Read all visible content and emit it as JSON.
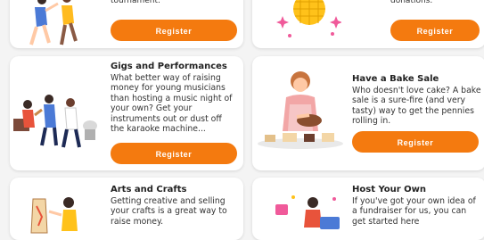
{
  "cards": [
    {
      "id": "top-left",
      "partial_text": "tournament.",
      "button": "Register"
    },
    {
      "id": "top-right",
      "partial_text": "donations.",
      "button": "Register"
    },
    {
      "id": "gigs",
      "title": "Gigs and Performances",
      "description": "What better way of raising money for young musicians than hosting a music night of your own? Get your instruments out or dust off the karaoke machine...",
      "button": "Register"
    },
    {
      "id": "bake",
      "title": "Have a Bake Sale",
      "description": "Who doesn't love cake? A bake sale is a sure-fire (and very tasty) way to get the pennies rolling in.",
      "button": "Register"
    },
    {
      "id": "arts",
      "title": "Arts and Crafts",
      "description": "Getting creative and selling your crafts is a great way to raise money."
    },
    {
      "id": "host",
      "title": "Host Your Own",
      "description": "If you've got your own idea of a fundraiser for us, you can get started here"
    }
  ],
  "colors": {
    "accent": "#f47a0f",
    "card": "#ffffff",
    "background": "#f4f4f4"
  }
}
